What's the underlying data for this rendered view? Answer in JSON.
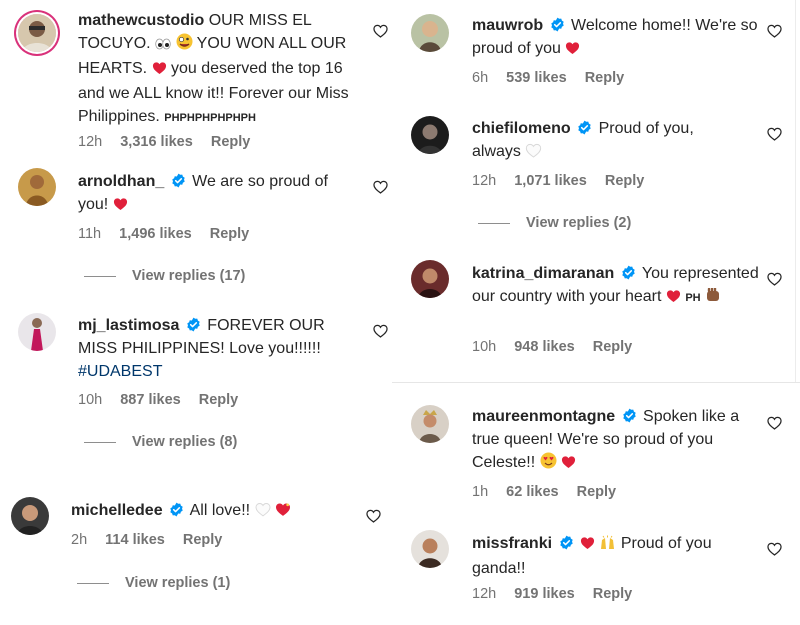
{
  "colors": {
    "text": "#262626",
    "muted": "#737373",
    "heart_red": "#e0203a",
    "verified_blue": "#0095f6",
    "hashtag": "#00376b"
  },
  "left": [
    {
      "username": "mathewcustodio",
      "verified": false,
      "text": "OUR MISS EL TOCUYO.",
      "text_cont": "YOU WON ALL OUR HEARTS.",
      "text_cont2": "you deserved the top 16 and we ALL know it!! Forever our Miss Philippines.",
      "small_tag": "PHPHPHPHPHPH",
      "time": "12h",
      "likes": "3,316 likes",
      "reply": "Reply",
      "icons": [
        "eyes-emoji",
        "zany-face-emoji",
        "red-heart-emoji"
      ]
    },
    {
      "username": "arnoldhan_",
      "verified": true,
      "text": "We are so proud of you!",
      "time": "11h",
      "likes": "1,496 likes",
      "reply": "Reply",
      "view_replies": "View replies (17)"
    },
    {
      "username": "mj_lastimosa",
      "verified": true,
      "text": "FOREVER OUR MISS PHILIPPINES! Love you!!!!!!",
      "hashtag": "#UDABEST",
      "time": "10h",
      "likes": "887 likes",
      "reply": "Reply",
      "view_replies": "View replies (8)"
    },
    {
      "username": "michelledee",
      "verified": true,
      "text": "All love!!",
      "time": "2h",
      "likes": "114 likes",
      "reply": "Reply",
      "view_replies": "View replies (1)"
    }
  ],
  "right": [
    {
      "username": "mauwrob",
      "verified": true,
      "text": "Welcome home!! We're so proud of you",
      "time": "6h",
      "likes": "539 likes",
      "reply": "Reply"
    },
    {
      "username": "chiefilomeno",
      "verified": true,
      "text": "Proud of you, always",
      "time": "12h",
      "likes": "1,071 likes",
      "reply": "Reply",
      "view_replies": "View replies (2)"
    },
    {
      "username": "katrina_dimaranan",
      "verified": true,
      "text": "You represented our country with your heart",
      "small_tag": "PH",
      "time": "10h",
      "likes": "948 likes",
      "reply": "Reply"
    },
    {
      "username": "maureenmontagne",
      "verified": true,
      "text": "Spoken like a true queen! We're so proud of you Celeste!!",
      "time": "1h",
      "likes": "62 likes",
      "reply": "Reply"
    },
    {
      "username": "missfranki",
      "verified": true,
      "text": "Proud of you ganda!!",
      "time": "12h",
      "likes": "919 likes",
      "reply": "Reply"
    }
  ]
}
